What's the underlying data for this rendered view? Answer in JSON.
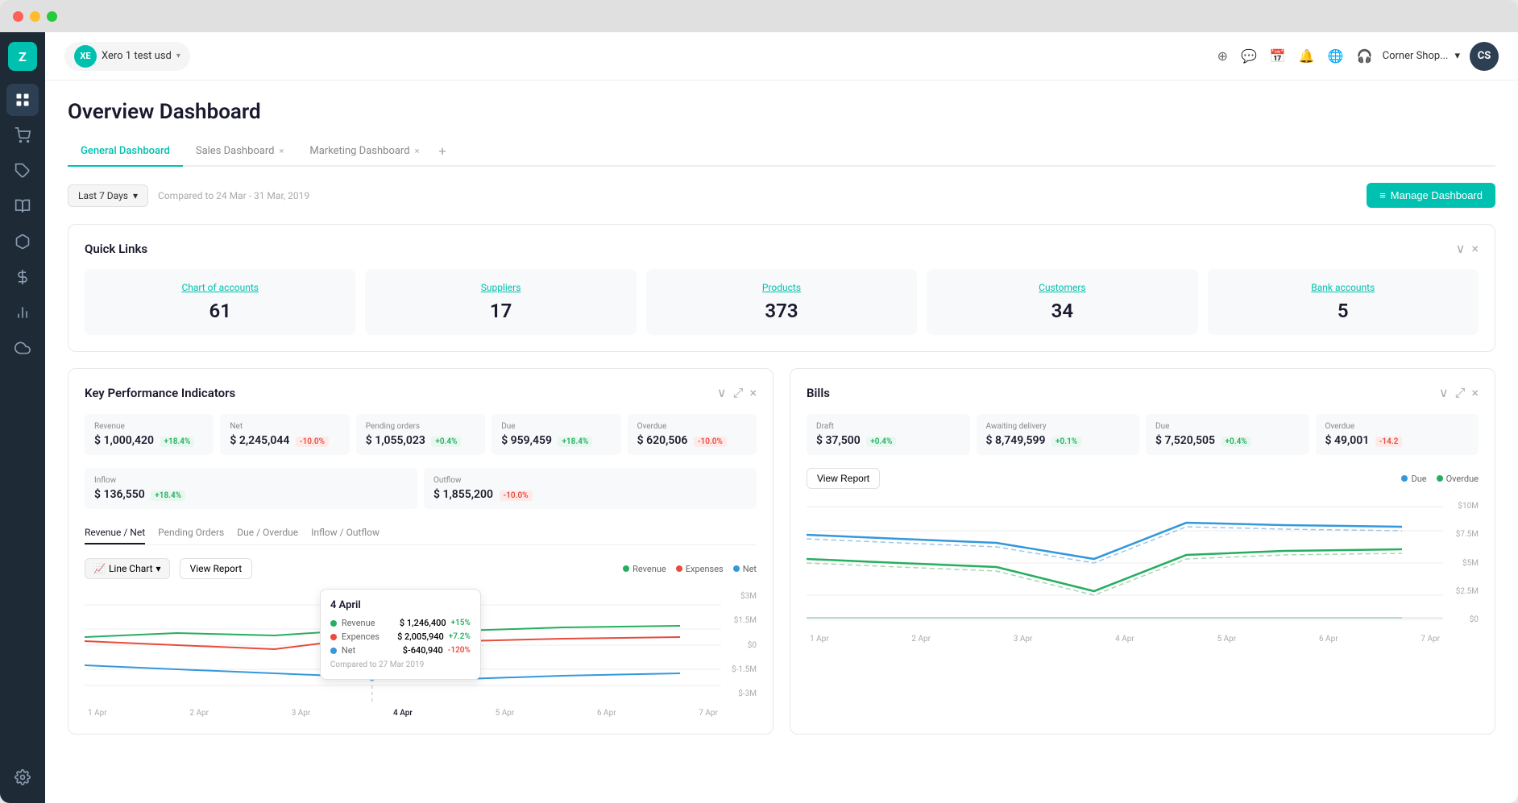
{
  "window": {
    "title": "Overview Dashboard"
  },
  "sidebar": {
    "logo": "Z",
    "items": [
      {
        "id": "dashboard",
        "icon": "grid"
      },
      {
        "id": "cart",
        "icon": "cart"
      },
      {
        "id": "tag",
        "icon": "tag"
      },
      {
        "id": "book",
        "icon": "book"
      },
      {
        "id": "box",
        "icon": "box"
      },
      {
        "id": "dollar",
        "icon": "dollar"
      },
      {
        "id": "bar-chart",
        "icon": "bar-chart"
      },
      {
        "id": "cloud",
        "icon": "cloud"
      },
      {
        "id": "settings",
        "icon": "settings"
      }
    ]
  },
  "topbar": {
    "org_badge": "XE",
    "org_name": "Xero 1 test usd",
    "corner_shop": "Corner Shop...",
    "icons": [
      "plus",
      "chat",
      "calendar",
      "bell",
      "globe",
      "support"
    ]
  },
  "page": {
    "title": "Overview Dashboard",
    "tabs": [
      {
        "label": "General Dashboard",
        "active": true,
        "closeable": false
      },
      {
        "label": "Sales Dashboard",
        "active": false,
        "closeable": true
      },
      {
        "label": "Marketing Dashboard",
        "active": false,
        "closeable": true
      }
    ]
  },
  "toolbar": {
    "date_filter": "Last 7 Days",
    "compare_text": "Compared to 24 Mar - 31 Mar, 2019",
    "manage_btn": "Manage Dashboard"
  },
  "quick_links": {
    "title": "Quick Links",
    "items": [
      {
        "label": "Chart of accounts",
        "value": "61"
      },
      {
        "label": "Suppliers",
        "value": "17"
      },
      {
        "label": "Products",
        "value": "373"
      },
      {
        "label": "Customers",
        "value": "34"
      },
      {
        "label": "Bank accounts",
        "value": "5"
      }
    ]
  },
  "kpi": {
    "title": "Key Performance Indicators",
    "items": [
      {
        "label": "Revenue",
        "value": "$ 1,000,420",
        "change": "+18.4%",
        "positive": true
      },
      {
        "label": "Net",
        "value": "$ 2,245,044",
        "change": "-10.0%",
        "positive": false
      },
      {
        "label": "Pending orders",
        "value": "$ 1,055,023",
        "change": "+0.4%",
        "positive": true
      },
      {
        "label": "Due",
        "value": "$ 959,459",
        "change": "+18.4%",
        "positive": true
      },
      {
        "label": "Overdue",
        "value": "$ 620,506",
        "change": "-10.0%",
        "positive": false
      }
    ],
    "items2": [
      {
        "label": "Inflow",
        "value": "$ 136,550",
        "change": "+18.4%",
        "positive": true
      },
      {
        "label": "Outflow",
        "value": "$ 1,855,200",
        "change": "-10.0%",
        "positive": false
      }
    ],
    "chart_tabs": [
      "Revenue / Net",
      "Pending Orders",
      "Due / Overdue",
      "Inflow / Outflow"
    ],
    "active_chart_tab": "Revenue / Net",
    "chart_type": "Line Chart",
    "view_report": "View Report",
    "legend": [
      {
        "label": "Revenue",
        "color": "#27ae60"
      },
      {
        "label": "Expenses",
        "color": "#e74c3c"
      },
      {
        "label": "Net",
        "color": "#3498db"
      }
    ],
    "x_labels": [
      "1 Apr",
      "2 Apr",
      "3 Apr",
      "4 Apr",
      "5 Apr",
      "6 Apr",
      "7 Apr"
    ],
    "y_labels": [
      "$3M",
      "$1.5M",
      "$0",
      "$-1.5M",
      "$-3M"
    ],
    "tooltip": {
      "date": "4 April",
      "rows": [
        {
          "label": "Revenue",
          "value": "$ 1,246,400",
          "change": "+15%",
          "positive": true,
          "color": "#27ae60"
        },
        {
          "label": "Expences",
          "value": "$ 2,005,940",
          "change": "+7.2%",
          "positive": true,
          "color": "#e74c3c"
        },
        {
          "label": "Net",
          "value": "$-640,940",
          "change": "-120%",
          "positive": false,
          "color": "#3498db"
        }
      ],
      "compare": "Compared to 27 Mar 2019"
    }
  },
  "bills": {
    "title": "Bills",
    "items": [
      {
        "label": "Draft",
        "value": "$ 37,500",
        "change": "+0.4%",
        "positive": true
      },
      {
        "label": "Awaiting delivery",
        "value": "$ 8,749,599",
        "change": "+0.1%",
        "positive": true
      },
      {
        "label": "Due",
        "value": "$ 7,520,505",
        "change": "+0.4%",
        "positive": true
      },
      {
        "label": "Overdue",
        "value": "$ 49,001",
        "change": "-14.2",
        "positive": false
      }
    ],
    "view_report": "View Report",
    "legend": [
      {
        "label": "Due",
        "color": "#3498db"
      },
      {
        "label": "Overdue",
        "color": "#27ae60"
      }
    ],
    "y_labels": [
      "$10M",
      "$7.5M",
      "$5M",
      "$2.5M",
      "$0"
    ],
    "x_labels": [
      "1 Apr",
      "2 Apr",
      "3 Apr",
      "4 Apr",
      "5 Apr",
      "6 Apr",
      "7 Apr"
    ]
  }
}
